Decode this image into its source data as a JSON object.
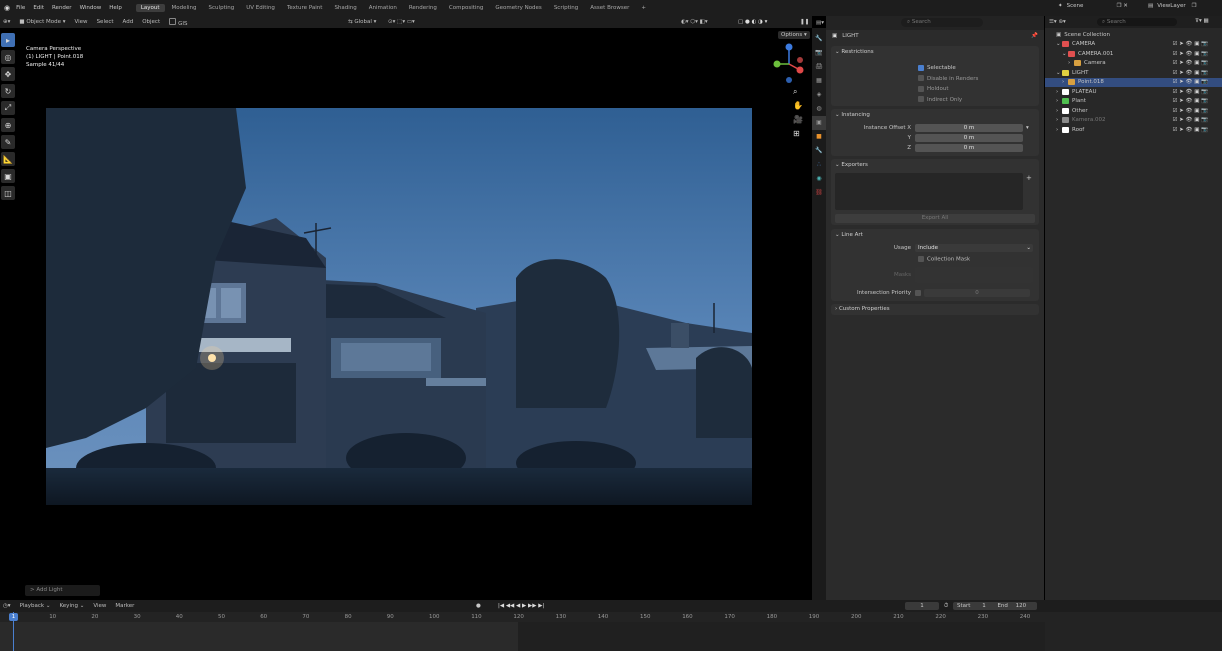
{
  "topbar": {
    "menus": [
      "File",
      "Edit",
      "Render",
      "Window",
      "Help"
    ],
    "workspaces": [
      "Layout",
      "Modeling",
      "Sculpting",
      "UV Editing",
      "Texture Paint",
      "Shading",
      "Animation",
      "Rendering",
      "Compositing",
      "Geometry Nodes",
      "Scripting",
      "Asset Browser"
    ],
    "active_workspace": "Layout",
    "add_tab": "+",
    "scene": "Scene",
    "view_layer": "ViewLayer"
  },
  "viewport_header": {
    "mode": "Object Mode",
    "menus": [
      "View",
      "Select",
      "Add",
      "Object"
    ],
    "gis": "GIS",
    "transform": "Global",
    "options": "Options"
  },
  "viewport": {
    "info_line1": "Camera Perspective",
    "info_line2": "(1) LIGHT | Point.018",
    "info_line3": "Sample 41/44",
    "last_operator": "> Add Light"
  },
  "properties": {
    "search_placeholder": "Search",
    "object_name": "LIGHT",
    "restrictions": {
      "title": "Restrictions",
      "selectable": "Selectable",
      "disable_in_renders": "Disable in Renders",
      "holdout": "Holdout",
      "indirect_only": "Indirect Only"
    },
    "instancing": {
      "title": "Instancing",
      "offset_label": "Instance Offset X",
      "y_label": "Y",
      "z_label": "Z",
      "x_value": "0 m",
      "y_value": "0 m",
      "z_value": "0 m"
    },
    "exporters": {
      "title": "Exporters",
      "export_all": "Export All"
    },
    "line_art": {
      "title": "Line Art",
      "usage_label": "Usage",
      "usage_value": "Include",
      "collection_mask": "Collection Mask",
      "masks_label": "Masks",
      "intersection_priority": "Intersection Priority",
      "priority_value": "0"
    },
    "custom_properties": "Custom Properties"
  },
  "outliner": {
    "search_placeholder": "Search",
    "root": "Scene Collection",
    "items": [
      {
        "name": "CAMERA",
        "indent": 0,
        "color": "#e05050",
        "expanded": true
      },
      {
        "name": "CAMERA.001",
        "indent": 1,
        "color": "#e05050",
        "expanded": true
      },
      {
        "name": "Camera",
        "indent": 2,
        "color": "#d8a040",
        "expanded": false
      },
      {
        "name": "LIGHT",
        "indent": 0,
        "color": "#e0d040",
        "expanded": true
      },
      {
        "name": "Point.018",
        "indent": 1,
        "color": "#d8a040",
        "expanded": false,
        "selected": true
      },
      {
        "name": "PLATEAU",
        "indent": 0,
        "color": "#ffffff",
        "expanded": false
      },
      {
        "name": "Plant",
        "indent": 0,
        "color": "#50c050",
        "expanded": false
      },
      {
        "name": "Other",
        "indent": 0,
        "color": "#ffffff",
        "expanded": false
      },
      {
        "name": "Kamera.002",
        "indent": 0,
        "color": "#8a8a8a",
        "expanded": false
      },
      {
        "name": "Roof",
        "indent": 0,
        "color": "#ffffff",
        "expanded": false
      }
    ]
  },
  "timeline": {
    "menus": [
      "Playback",
      "Keying",
      "View",
      "Marker"
    ],
    "current_frame": "1",
    "start_label": "Start",
    "start": "1",
    "end_label": "End",
    "end": "120",
    "ticks": [
      "10",
      "20",
      "30",
      "40",
      "50",
      "60",
      "70",
      "80",
      "90",
      "100",
      "110",
      "120",
      "130",
      "140",
      "150",
      "160",
      "170",
      "180",
      "190",
      "200",
      "210",
      "220",
      "230",
      "240"
    ],
    "playhead": "1"
  },
  "colors": {
    "accent": "#4a7fcf",
    "selected_row": "#334d80",
    "header": "#1d1d1d",
    "panel": "#2b2b2b"
  }
}
